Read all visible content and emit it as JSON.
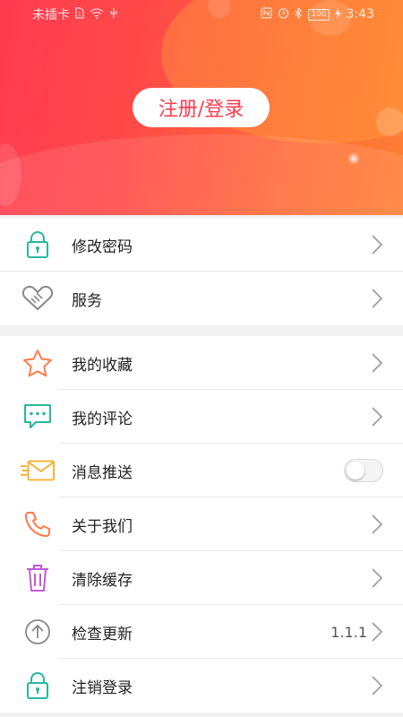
{
  "status_bar": {
    "carrier": "未插卡",
    "time": "3:43",
    "battery": "100",
    "icons": [
      "sim-icon",
      "wifi-icon",
      "usb-icon",
      "nfc-icon",
      "alarm-icon",
      "bluetooth-icon",
      "battery-icon",
      "charging-icon"
    ]
  },
  "header": {
    "login_label": "注册/登录",
    "colors": {
      "gradient_start": "#ff3b4f",
      "gradient_end": "#ff7f34"
    }
  },
  "group1": {
    "items": [
      {
        "label": "修改密码",
        "icon": "lock-icon",
        "color": "#27b7a0"
      },
      {
        "label": "服务",
        "icon": "handshake-icon",
        "color": "#888888"
      }
    ]
  },
  "group2": {
    "items": [
      {
        "label": "我的收藏",
        "icon": "star-icon",
        "color": "#ff7a4a"
      },
      {
        "label": "我的评论",
        "icon": "comment-icon",
        "color": "#27b7a0"
      },
      {
        "label": "消息推送",
        "icon": "message-icon",
        "color": "#f5b030",
        "toggle_on": false
      },
      {
        "label": "关于我们",
        "icon": "phone-icon",
        "color": "#ff7a4a"
      },
      {
        "label": "清除缓存",
        "icon": "trash-icon",
        "color": "#c05ad8"
      },
      {
        "label": "检查更新",
        "icon": "upload-icon",
        "color": "#888888",
        "value": "1.1.1"
      },
      {
        "label": "注销登录",
        "icon": "lock-icon",
        "color": "#27b7a0"
      }
    ]
  }
}
